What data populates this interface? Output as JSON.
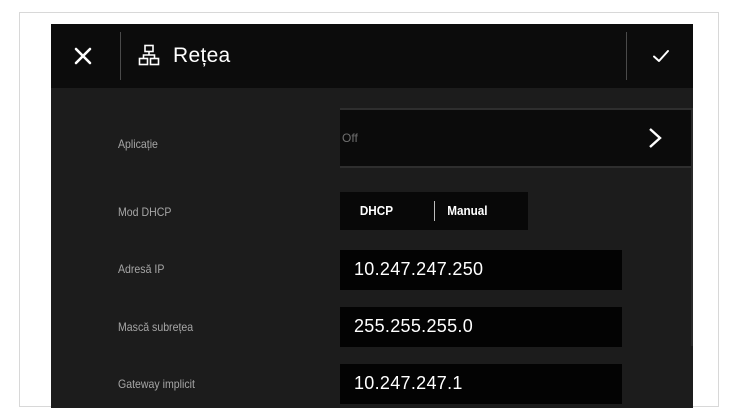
{
  "header": {
    "title": "Rețea",
    "close_icon": "close-icon",
    "network_icon": "network-icon",
    "confirm_icon": "checkmark-icon"
  },
  "settings": {
    "application": {
      "label": "Aplicație",
      "value": "Off"
    },
    "dhcp_mode": {
      "label": "Mod DHCP",
      "options": [
        "DHCP",
        "Manual"
      ]
    },
    "ip_address": {
      "label": "Adresă IP",
      "value": "10.247.247.250"
    },
    "subnet_mask": {
      "label": "Mască subrețea",
      "value": "255.255.255.0"
    },
    "default_gateway": {
      "label": "Gateway implicit",
      "value": "10.247.247.1"
    }
  },
  "colors": {
    "background": "#1c1c1c",
    "header": "#0c0c0c",
    "field": "#030303",
    "label": "#a6a6a6",
    "text": "#ffffff"
  }
}
